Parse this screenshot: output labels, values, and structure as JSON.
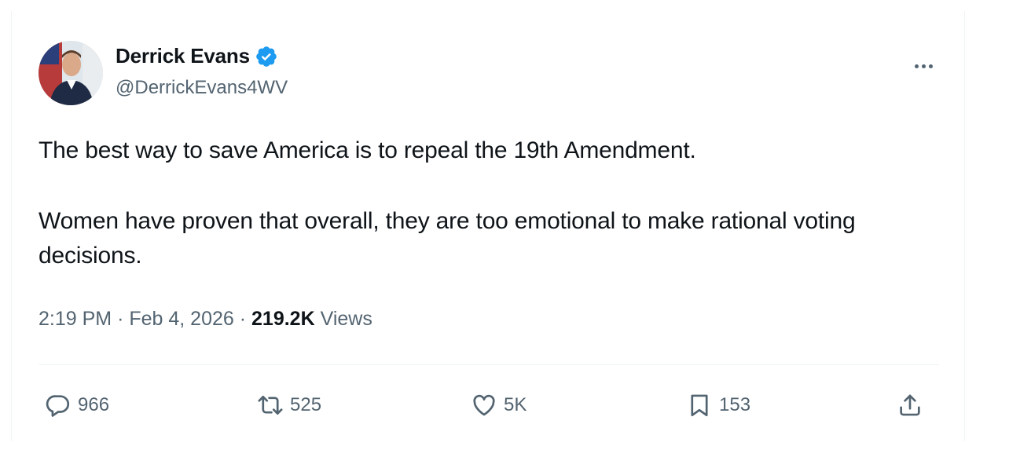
{
  "author": {
    "display_name": "Derrick Evans",
    "handle": "@DerrickEvans4WV",
    "verified_color": "#1d9bf0",
    "avatar_icon": "profile-photo"
  },
  "tweet": {
    "paragraphs": [
      "The best way to save America is to repeal the 19th Amendment.",
      "Women have proven that overall, they are too emotional to make rational voting decisions."
    ]
  },
  "meta": {
    "time": "2:19 PM",
    "separator": "·",
    "date": "Feb 4, 2026",
    "views_count": "219.2K",
    "views_label": "Views"
  },
  "actions": {
    "replies": "966",
    "reposts": "525",
    "likes": "5K",
    "bookmarks": "153"
  },
  "colors": {
    "text_primary": "#0f1419",
    "text_secondary": "#536471",
    "divider": "#eff3f4",
    "accent": "#1d9bf0"
  }
}
